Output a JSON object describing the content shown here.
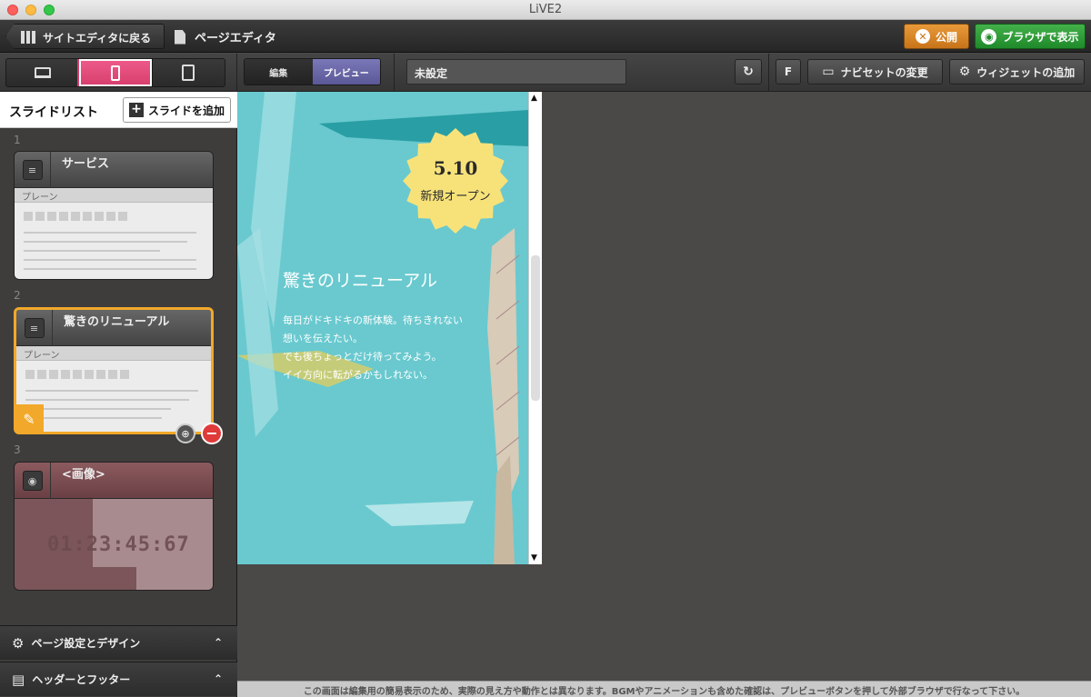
{
  "window": {
    "title": "LiVE2"
  },
  "toolbar": {
    "back_label": "サイトエディタに戻る",
    "page_editor_label": "ページエディタ",
    "publish_label": "公開",
    "browser_label": "ブラウザで表示"
  },
  "editbar": {
    "mode_edit": "編集",
    "mode_preview": "プレビュー",
    "page_title_value": "未設定",
    "font_button": "F",
    "navset_label": "ナビセットの変更",
    "widget_label": "ウィジェットの追加"
  },
  "sidebar": {
    "title": "スライドリスト",
    "add_slide_label": "スライドを追加",
    "slides": [
      {
        "num": "1",
        "title": "サービス",
        "type": "プレーン"
      },
      {
        "num": "2",
        "title": "驚きのリニューアル",
        "type": "プレーン"
      },
      {
        "num": "3",
        "title": "<画像>",
        "timer": "01:23:45:67"
      }
    ],
    "panel_design": "ページ設定とデザイン",
    "panel_header_footer": "ヘッダーとフッター"
  },
  "preview": {
    "badge_date": "5.10",
    "badge_text": "新規オープン",
    "heading": "驚きのリニューアル",
    "lines": [
      "毎日がドキドキの新体験。待ちきれない",
      "想いを伝えたい。",
      "でも後ちょっとだけ待ってみよう。",
      "イイ方向に転がるかもしれない。"
    ]
  },
  "footer_note": "この画面は編集用の簡易表示のため、実際の見え方や動作とは異なります。BGMやアニメーションも含めた確認は、プレビューボタンを押して外部ブラウザで行なって下さい。",
  "colors": {
    "accent_pink": "#d63d6d",
    "selected_orange": "#f2a82a",
    "publish_orange": "#c8741a",
    "browser_green": "#1f8a2a",
    "preview_teal": "#69c9cf"
  }
}
